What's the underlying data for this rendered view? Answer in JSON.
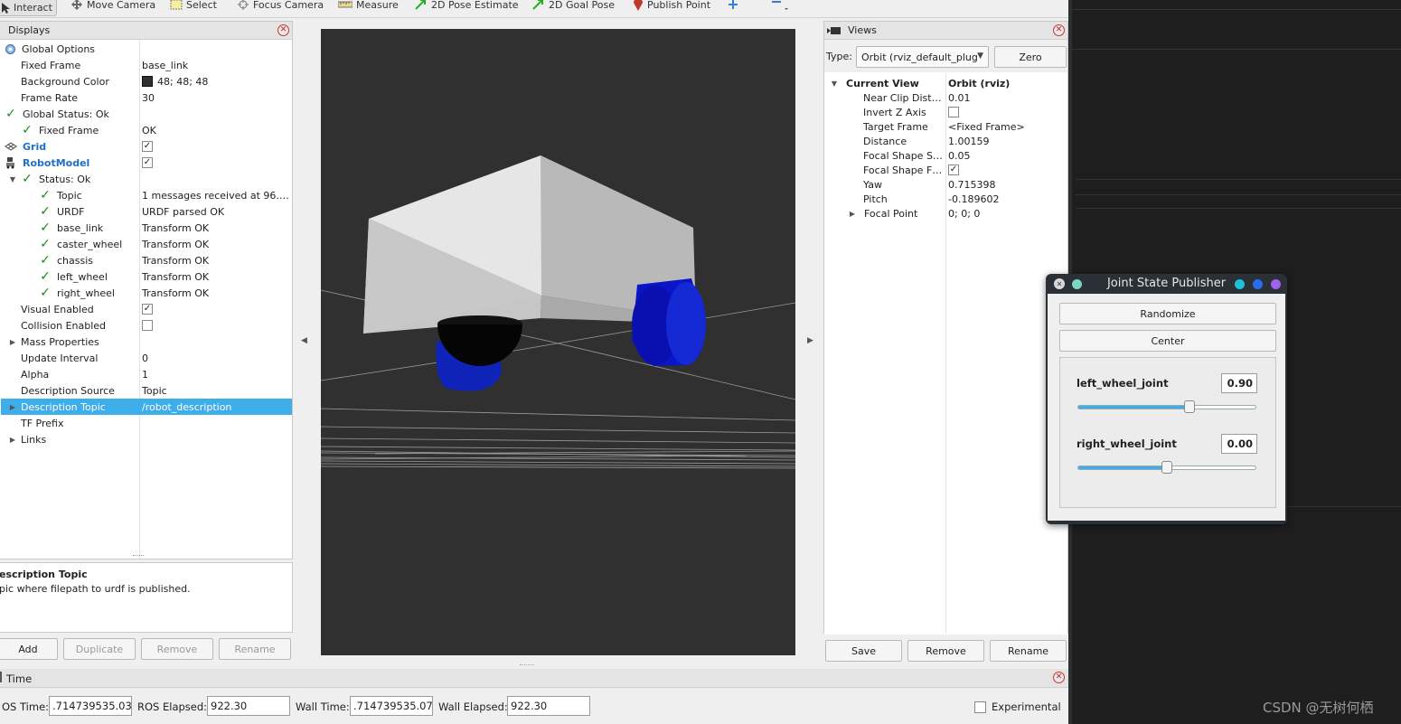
{
  "toolbar": {
    "interact": "Interact",
    "move_camera": "Move Camera",
    "select": "Select",
    "focus_camera": "Focus Camera",
    "measure": "Measure",
    "pose_estimate": "2D Pose Estimate",
    "goal_pose": "2D Goal Pose",
    "publish_point": "Publish Point"
  },
  "displays": {
    "title": "Displays",
    "rows": [
      {
        "key": "Global Options",
        "value": ""
      },
      {
        "key": "Fixed Frame",
        "value": "base_link"
      },
      {
        "key": "Background Color",
        "value": "48; 48; 48"
      },
      {
        "key": "Frame Rate",
        "value": "30"
      },
      {
        "key": "Global Status: Ok",
        "value": ""
      },
      {
        "key": "Fixed Frame",
        "value": "OK"
      },
      {
        "key": "Grid",
        "value": ""
      },
      {
        "key": "RobotModel",
        "value": ""
      },
      {
        "key": "Status: Ok",
        "value": ""
      },
      {
        "key": "Topic",
        "value": "1 messages received at 96.…"
      },
      {
        "key": "URDF",
        "value": "URDF parsed OK"
      },
      {
        "key": "base_link",
        "value": "Transform OK"
      },
      {
        "key": "caster_wheel",
        "value": "Transform OK"
      },
      {
        "key": "chassis",
        "value": "Transform OK"
      },
      {
        "key": "left_wheel",
        "value": "Transform OK"
      },
      {
        "key": "right_wheel",
        "value": "Transform OK"
      },
      {
        "key": "Visual Enabled",
        "value": ""
      },
      {
        "key": "Collision Enabled",
        "value": ""
      },
      {
        "key": "Mass Properties",
        "value": ""
      },
      {
        "key": "Update Interval",
        "value": "0"
      },
      {
        "key": "Alpha",
        "value": "1"
      },
      {
        "key": "Description Source",
        "value": "Topic"
      },
      {
        "key": "Description Topic",
        "value": "/robot_description"
      },
      {
        "key": "TF Prefix",
        "value": ""
      },
      {
        "key": "Links",
        "value": ""
      }
    ],
    "help_title": "escription Topic",
    "help_text": "pic where filepath to urdf is published.",
    "buttons": {
      "add": "Add",
      "duplicate": "Duplicate",
      "remove": "Remove",
      "rename": "Rename"
    }
  },
  "views": {
    "title": "Views",
    "type_label": "Type:",
    "type_value": "Orbit (rviz_default_plug",
    "zero": "Zero",
    "rows": [
      {
        "key": "Current View",
        "value": "Orbit (rviz)"
      },
      {
        "key": "Near Clip Dist…",
        "value": "0.01"
      },
      {
        "key": "Invert Z Axis",
        "value": ""
      },
      {
        "key": "Target Frame",
        "value": "<Fixed Frame>"
      },
      {
        "key": "Distance",
        "value": "1.00159"
      },
      {
        "key": "Focal Shape S…",
        "value": "0.05"
      },
      {
        "key": "Focal Shape F…",
        "value": ""
      },
      {
        "key": "Yaw",
        "value": "0.715398"
      },
      {
        "key": "Pitch",
        "value": "-0.189602"
      },
      {
        "key": "Focal Point",
        "value": "0; 0; 0"
      }
    ],
    "buttons": {
      "save": "Save",
      "remove": "Remove",
      "rename": "Rename"
    }
  },
  "time": {
    "title": "Time",
    "ros_time_label": "OS Time:",
    "ros_time": ".714739535.03",
    "ros_elapsed_label": "ROS Elapsed:",
    "ros_elapsed": "922.30",
    "wall_time_label": "Wall Time:",
    "wall_time": ".714739535.07",
    "wall_elapsed_label": "Wall Elapsed:",
    "wall_elapsed": "922.30",
    "experimental": "Experimental"
  },
  "jsp": {
    "title": "Joint State Publisher",
    "randomize": "Randomize",
    "center": "Center",
    "joints": [
      {
        "name": "left_wheel_joint",
        "value": "0.90",
        "level": 0.63
      },
      {
        "name": "right_wheel_joint",
        "value": "0.00",
        "level": 0.5
      }
    ]
  },
  "watermark": "CSDN @无树何栖",
  "colors": {
    "viewport_bg": "#303030",
    "selection": "#3daee9",
    "wheel": "#0a14c8"
  }
}
